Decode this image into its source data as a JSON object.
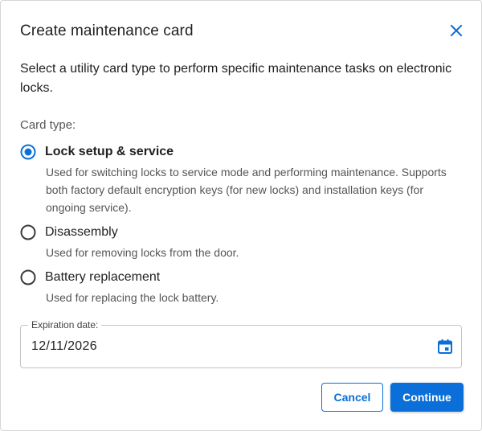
{
  "dialog": {
    "title": "Create maintenance card",
    "description": "Select a utility card type to perform specific maintenance tasks on electronic locks.",
    "close_icon": "close-icon"
  },
  "card_type": {
    "label": "Card type:",
    "selected": "lock-setup",
    "options": [
      {
        "id": "lock-setup",
        "title": "Lock setup & service",
        "description": "Used for switching locks to service mode and performing maintenance. Supports both factory default encryption keys (for new locks) and installation keys (for ongoing service)."
      },
      {
        "id": "disassembly",
        "title": "Disassembly",
        "description": "Used for removing locks from the door."
      },
      {
        "id": "battery",
        "title": "Battery replacement",
        "description": "Used for replacing the lock battery."
      }
    ]
  },
  "expiration": {
    "label": "Expiration date:",
    "value": "12/11/2026",
    "icon": "calendar-icon"
  },
  "actions": {
    "cancel_label": "Cancel",
    "continue_label": "Continue"
  },
  "colors": {
    "accent": "#0a6fd8",
    "text": "#1f1f1f",
    "secondary_text": "#555555"
  }
}
